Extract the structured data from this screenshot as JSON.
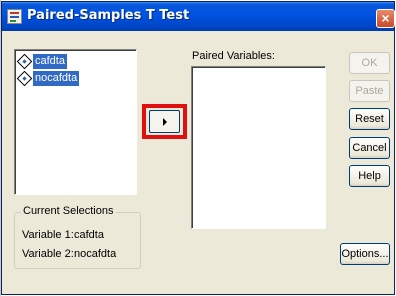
{
  "window": {
    "title": "Paired-Samples T Test",
    "close_label": "×"
  },
  "source_list": {
    "items": [
      {
        "label": "cafdta",
        "selected": true
      },
      {
        "label": "nocafdta",
        "selected": true
      }
    ]
  },
  "paired_variables": {
    "label": "Paired Variables:",
    "items": []
  },
  "move_button": {
    "icon": "right-arrow-icon",
    "highlight_color": "#e01010"
  },
  "buttons": {
    "ok": {
      "label": "OK",
      "enabled": false
    },
    "paste": {
      "label": "Paste",
      "enabled": false
    },
    "reset": {
      "label": "Reset",
      "enabled": true
    },
    "cancel": {
      "label": "Cancel",
      "enabled": true
    },
    "help": {
      "label": "Help",
      "enabled": true
    },
    "options": {
      "label": "Options...",
      "enabled": true
    }
  },
  "current_selections": {
    "title": "Current Selections",
    "variable1": {
      "label": "Variable 1:",
      "value": "cafdta"
    },
    "variable2": {
      "label": "Variable 2:",
      "value": "nocafdta"
    }
  },
  "colors": {
    "titlebar": "#0054e3",
    "dialog_bg": "#ece9d8",
    "selection": "#316ac5",
    "highlight_box": "#e01010"
  }
}
